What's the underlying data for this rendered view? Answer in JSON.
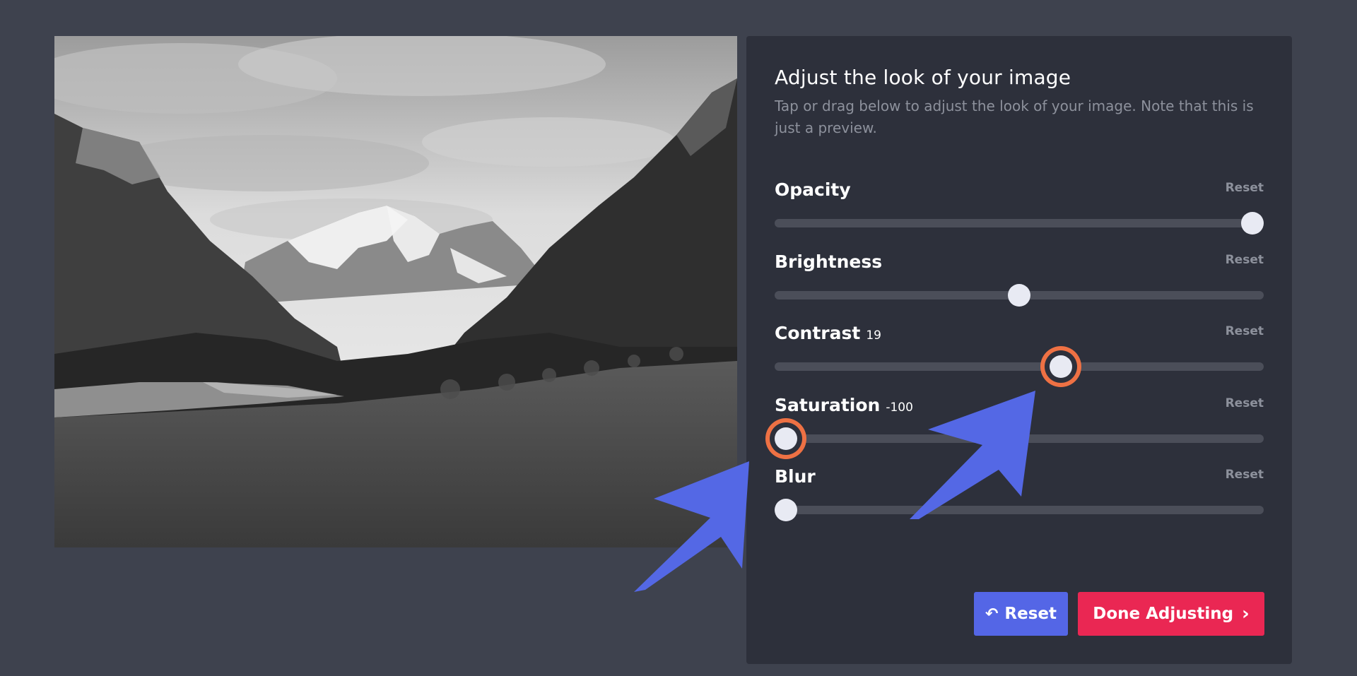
{
  "panel": {
    "title": "Adjust the look of your image",
    "description": "Tap or drag below to adjust the look of your image. Note that this is just a preview."
  },
  "controls": [
    {
      "label": "Opacity",
      "value": "",
      "reset": "Reset",
      "level": 1.0,
      "highlighted": false
    },
    {
      "label": "Brightness",
      "value": "",
      "reset": "Reset",
      "level": 0.5,
      "highlighted": false
    },
    {
      "label": "Contrast",
      "value": "19",
      "reset": "Reset",
      "level": 0.59,
      "highlighted": true
    },
    {
      "label": "Saturation",
      "value": "-100",
      "reset": "Reset",
      "level": 0.0,
      "highlighted": true
    },
    {
      "label": "Blur",
      "value": "",
      "reset": "Reset",
      "level": 0.0,
      "highlighted": false
    }
  ],
  "buttons": {
    "reset_label": "Reset",
    "done_label": "Done Adjusting"
  },
  "colors": {
    "background": "#3e424e",
    "panel": "#2d303b",
    "accent_blue": "#5466e6",
    "accent_red": "#ea2753",
    "highlight_ring": "#ee7144",
    "arrow": "#5468e5"
  },
  "icons": {
    "reset": "undo-icon",
    "done": "chevron-right-icon"
  }
}
